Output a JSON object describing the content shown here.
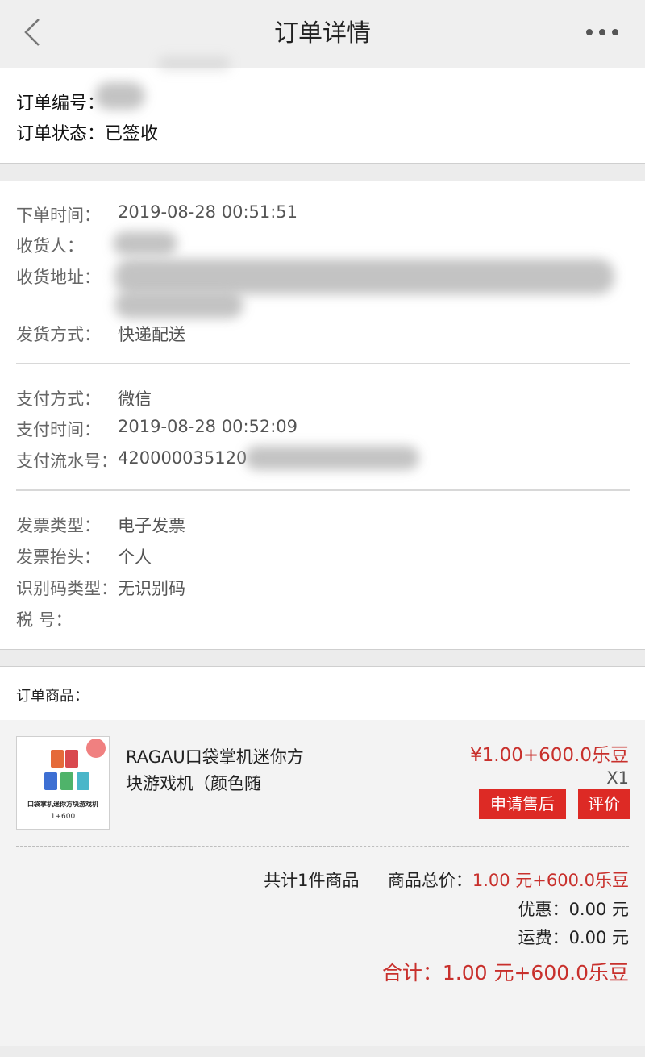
{
  "header": {
    "title": "订单详情"
  },
  "order": {
    "number_label": "订单编号：",
    "status_label": "订单状态：",
    "status_value": "已签收"
  },
  "info": {
    "order_time_label": "下单时间：",
    "order_time_value": "2019-08-28 00:51:51",
    "receiver_label": "收货人：",
    "address_label": "收货地址：",
    "shipping_method_label": "发货方式：",
    "shipping_method_value": "快递配送",
    "pay_method_label": "支付方式：",
    "pay_method_value": "微信",
    "pay_time_label": "支付时间：",
    "pay_time_value": "2019-08-28 00:52:09",
    "pay_serial_label": "支付流水号：",
    "pay_serial_value": "420000035120",
    "invoice_type_label": "发票类型：",
    "invoice_type_value": "电子发票",
    "invoice_title_label": "发票抬头：",
    "invoice_title_value": "个人",
    "id_code_type_label": "识别码类型：",
    "id_code_type_value": "无识别码",
    "tax_no_label": "税 号："
  },
  "goods": {
    "section_label": "订单商品：",
    "items": [
      {
        "name": "RAGAU口袋掌机迷你方块游戏机（颜色随",
        "price": "¥1.00+600.0乐豆",
        "qty": "X1",
        "thumb_caption": "口袋掌机迷你方块游戏机",
        "thumb_price": "1+600"
      }
    ],
    "after_sale_button": "申请售后",
    "review_button": "评价"
  },
  "summary": {
    "count_text": "共计1件商品",
    "goods_total_label": "商品总价：",
    "goods_total_value": "1.00 元+600.0乐豆",
    "discount_label": "优惠：",
    "discount_value": "0.00 元",
    "freight_label": "运费：",
    "freight_value": "0.00 元",
    "total_label": "合计：",
    "total_value": "1.00 元+600.0乐豆"
  },
  "colors": {
    "accent": "#dd2a25",
    "price_red": "#c8302c"
  }
}
